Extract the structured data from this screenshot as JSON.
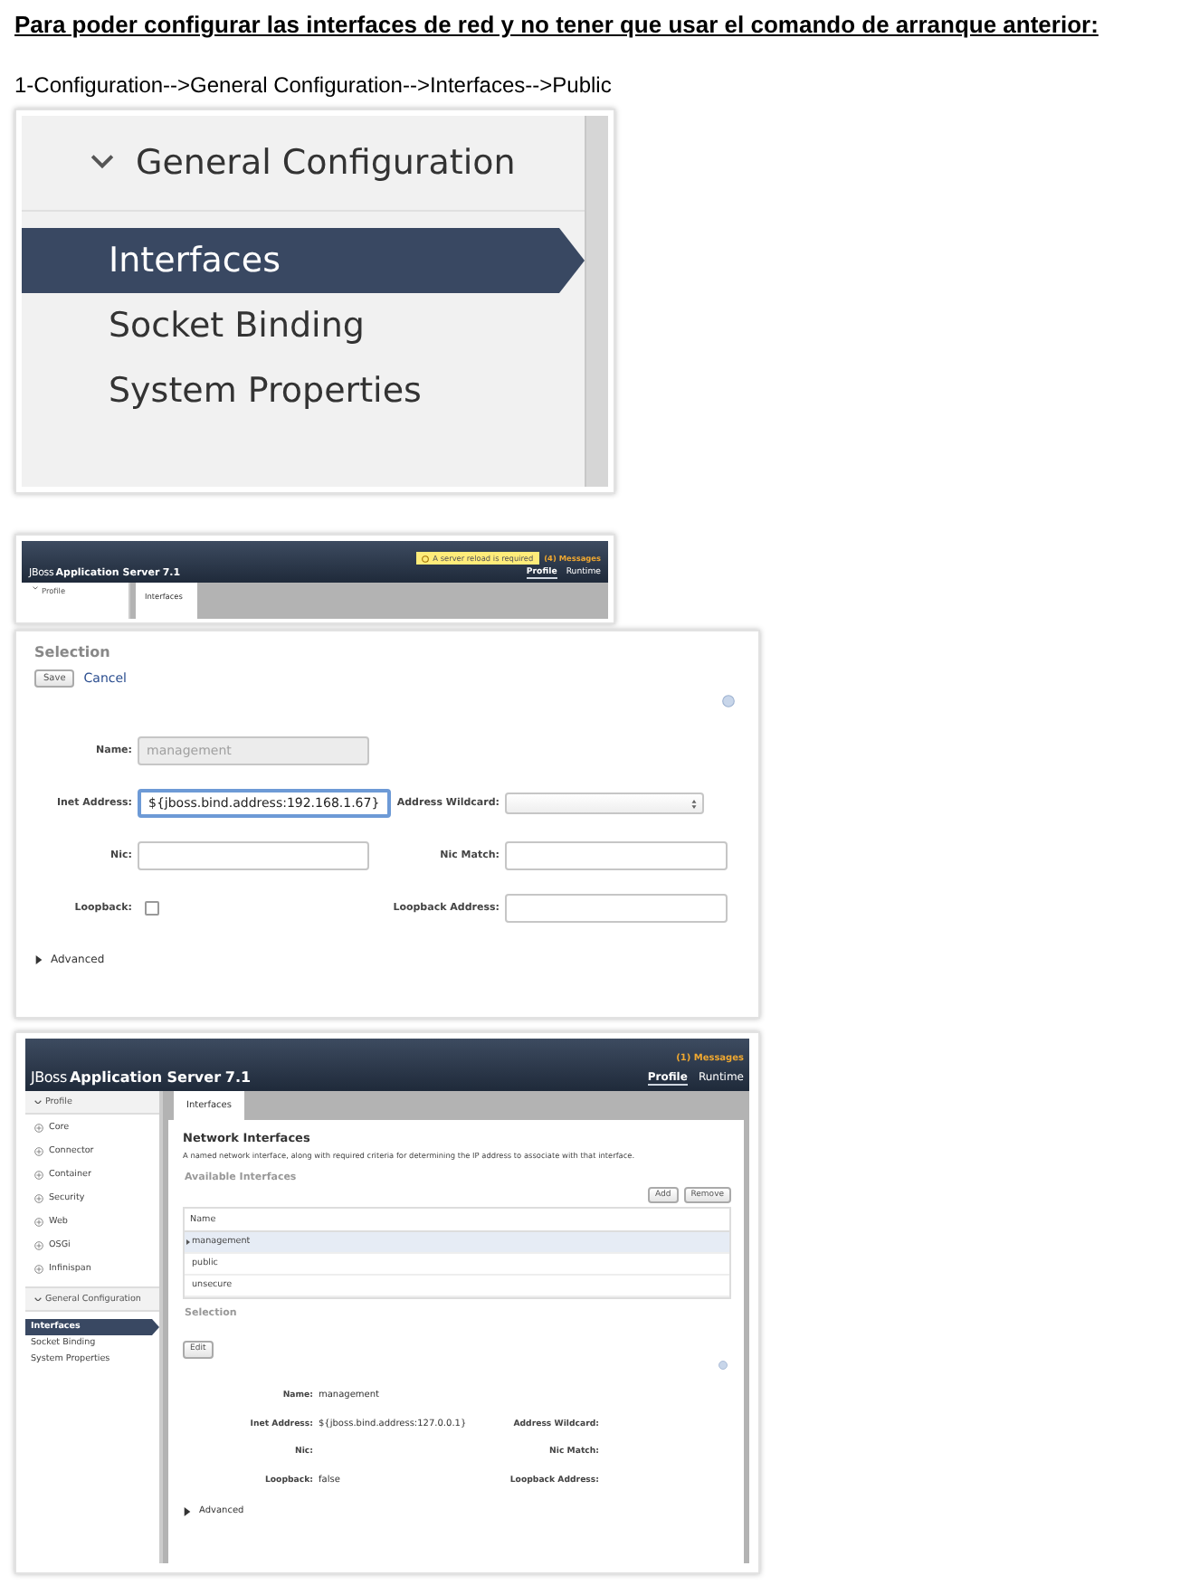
{
  "heading": "Para poder configurar las interfaces de red y no tener que usar el comando de arranque anterior:",
  "instruction": "1-Configuration-->General Configuration-->Interfaces-->Public",
  "menu_closeup": {
    "section": {
      "label": "General Configuration",
      "expanded": true
    },
    "items": [
      {
        "label": "Interfaces",
        "selected": true
      },
      {
        "label": "Socket Binding",
        "selected": false
      },
      {
        "label": "System Properties",
        "selected": false
      }
    ]
  },
  "header_closeup": {
    "brand": {
      "light": "JBoss",
      "bold": "Application Server",
      "version": "7.1"
    },
    "alert": "A server reload is required",
    "messages": "(4) Messages",
    "nav": [
      {
        "label": "Profile",
        "selected": true
      },
      {
        "label": "Runtime",
        "selected": false
      }
    ],
    "sidebar_section": {
      "label": "Profile",
      "expanded": true
    },
    "tabs": [
      {
        "label": "Interfaces",
        "selected": true
      }
    ]
  },
  "edit_form": {
    "title": "Selection",
    "save": "Save",
    "cancel": "Cancel",
    "rows": [
      [
        {
          "kind": "text",
          "label": "Name:",
          "value": "management",
          "disabled": true,
          "focused": false
        }
      ],
      [
        {
          "kind": "text",
          "label": "Inet Address:",
          "value": "${jboss.bind.address:192.168.1.67}",
          "disabled": false,
          "focused": true
        },
        {
          "kind": "select",
          "label": "Address Wildcard:"
        }
      ],
      [
        {
          "kind": "text",
          "label": "Nic:",
          "disabled": false,
          "focused": false
        },
        {
          "kind": "text",
          "label": "Nic Match:",
          "disabled": false,
          "focused": false
        }
      ],
      [
        {
          "kind": "checkbox",
          "label": "Loopback:",
          "checked": false
        },
        {
          "kind": "text",
          "label": "Loopback Address:",
          "disabled": false,
          "focused": false
        }
      ]
    ],
    "advanced": {
      "label": "Advanced",
      "expanded": false
    }
  },
  "console": {
    "brand": {
      "light": "JBoss",
      "bold": "Application Server",
      "version": "7.1"
    },
    "messages": "(1) Messages",
    "nav": [
      {
        "label": "Profile",
        "selected": true
      },
      {
        "label": "Runtime",
        "selected": false
      }
    ],
    "sidebar": [
      {
        "label": "Profile",
        "expanded": true,
        "items": [
          {
            "kind": "group",
            "label": "Core"
          },
          {
            "kind": "group",
            "label": "Connector"
          },
          {
            "kind": "group",
            "label": "Container"
          },
          {
            "kind": "group",
            "label": "Security"
          },
          {
            "kind": "group",
            "label": "Web"
          },
          {
            "kind": "group",
            "label": "OSGi"
          },
          {
            "kind": "group",
            "label": "Infinispan"
          }
        ]
      },
      {
        "label": "General Configuration",
        "expanded": true,
        "items": [
          {
            "kind": "link",
            "label": "Interfaces",
            "selected": true
          },
          {
            "kind": "link",
            "label": "Socket Binding",
            "selected": false
          },
          {
            "kind": "link",
            "label": "System Properties",
            "selected": false
          }
        ]
      }
    ],
    "tabs": [
      {
        "label": "Interfaces",
        "selected": true
      }
    ],
    "title": "Network Interfaces",
    "description": "A named network interface, along with required criteria for determining the IP address to associate with that interface.",
    "list_title": "Available Interfaces",
    "actions": [
      "Add",
      "Remove"
    ],
    "table": {
      "columns": [
        "Name"
      ],
      "rows": [
        {
          "name": "management",
          "selected": true
        },
        {
          "name": "public",
          "selected": false
        },
        {
          "name": "unsecure",
          "selected": false
        }
      ]
    },
    "selection": {
      "title": "Selection",
      "edit": "Edit",
      "rows": [
        [
          {
            "label": "Name:",
            "value": "management"
          }
        ],
        [
          {
            "label": "Inet Address:",
            "value": "${jboss.bind.address:127.0.0.1}"
          },
          {
            "label": "Address Wildcard:"
          }
        ],
        [
          {
            "label": "Nic:"
          },
          {
            "label": "Nic Match:"
          }
        ],
        [
          {
            "label": "Loopback:",
            "value": "false"
          },
          {
            "label": "Loopback Address:"
          }
        ]
      ],
      "advanced": {
        "label": "Advanced",
        "expanded": false
      }
    }
  }
}
